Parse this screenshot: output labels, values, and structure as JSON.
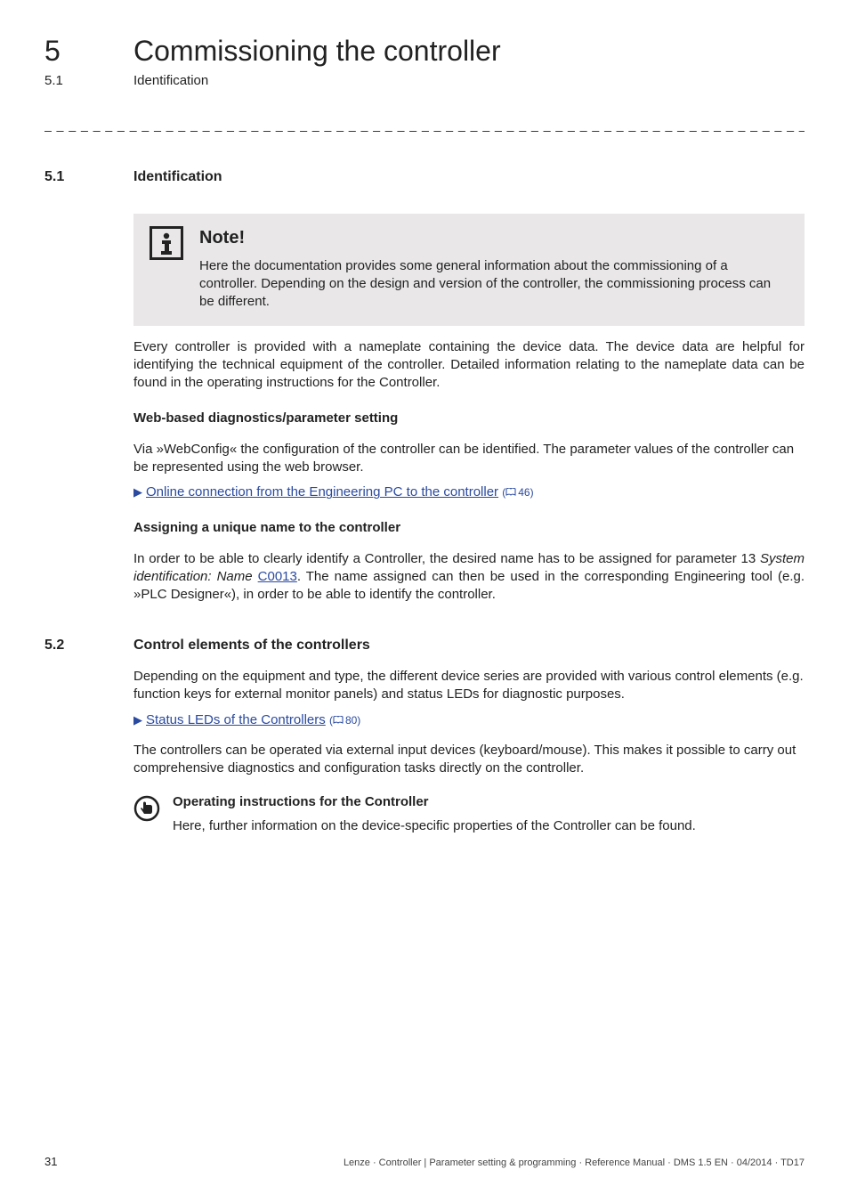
{
  "header": {
    "chapter_number": "5",
    "chapter_title": "Commissioning the controller",
    "sub_number": "5.1",
    "sub_title": "Identification"
  },
  "separator": "_ _ _ _ _ _ _ _ _ _ _ _ _ _ _ _ _ _ _ _ _ _ _ _ _ _ _ _ _ _ _ _ _ _ _ _ _ _ _ _ _ _ _ _ _ _ _ _ _ _ _ _ _ _ _ _ _ _ _ _ _ _ _ _",
  "section51": {
    "number": "5.1",
    "title": "Identification",
    "note": {
      "title": "Note!",
      "body": "Here the documentation provides some general information about the commissioning of a controller. Depending on the design and version of the controller, the commissioning process can be different."
    },
    "para1": "Every controller is provided with a nameplate containing the device data. The device data are helpful for identifying the technical equipment of the controller. Detailed information relating to the nameplate data can be found in the operating instructions for the Controller.",
    "sub1_title": "Web-based diagnostics/parameter setting",
    "sub1_para": "Via »WebConfig« the configuration of the controller can be identified. The parameter values of the controller can be represented using the web browser.",
    "sub1_link_text": "Online connection from the Engineering PC to the controller",
    "sub1_link_ref": "46)",
    "sub2_title": "Assigning a unique name to the controller",
    "sub2_para_pre": "In order to be able to clearly identify a Controller, the desired name has to be assigned for parameter 13 ",
    "sub2_para_italic": "System identification: Name",
    "sub2_para_link": "C0013",
    "sub2_para_post": ". The name assigned can then be used in the corresponding Engineering tool (e.g. »PLC Designer«), in order to be able to identify the controller."
  },
  "section52": {
    "number": "5.2",
    "title": "Control elements of the controllers",
    "para1": "Depending on the equipment and type, the different device series are provided with various control elements (e.g. function keys for external monitor panels) and status LEDs for diagnostic purposes.",
    "link_text": "Status LEDs of the Controllers",
    "link_ref": "80)",
    "para2": "The controllers can be operated via external input devices (keyboard/mouse). This makes it possible to carry out comprehensive diagnostics and configuration tasks directly on the controller.",
    "tip_title": "Operating instructions for the Controller",
    "tip_body": "Here, further information on the device-specific properties of the Controller can be found."
  },
  "footer": {
    "page": "31",
    "text": "Lenze · Controller | Parameter setting & programming · Reference Manual · DMS 1.5 EN · 04/2014 · TD17"
  }
}
